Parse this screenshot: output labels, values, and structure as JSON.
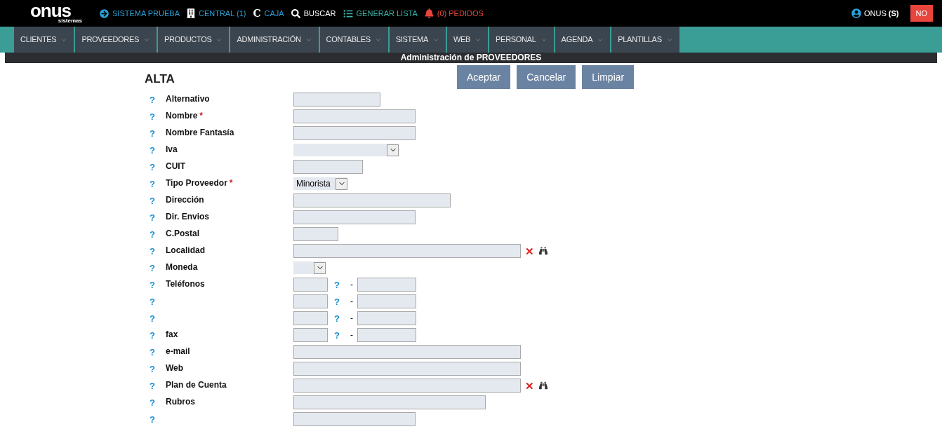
{
  "logo": {
    "word": "onus",
    "sub": "sistemas"
  },
  "topbar": [
    {
      "kind": "arrow",
      "label": "SISTEMA PRUEBA"
    },
    {
      "kind": "building",
      "label": "CENTRAL (1)"
    },
    {
      "kind": "letter",
      "glyph": "C",
      "label": "CAJA"
    },
    {
      "kind": "search",
      "label": "BUSCAR"
    },
    {
      "kind": "list",
      "label": "GENERAR LISTA"
    },
    {
      "kind": "bell",
      "label": "(0) PEDIDOS"
    }
  ],
  "user": {
    "name": "ONUS",
    "tag": "(S)"
  },
  "no_button": "NO",
  "menu": [
    "CLIENTES",
    "PROVEEDORES",
    "PRODUCTOS",
    "ADMINISTRACIÓN",
    "CONTABLES",
    "SISTEMA",
    "WEB",
    "PERSONAL",
    "AGENDA",
    "PLANTILLAS"
  ],
  "section_title": "Administración de PROVEEDORES",
  "form_title": "ALTA",
  "buttons": [
    "Aceptar",
    "Cancelar",
    "Limpiar"
  ],
  "fields": [
    {
      "help": "?",
      "label": "Alternativo",
      "kind": "text"
    },
    {
      "help": "?",
      "label": "Nombre",
      "required_mark": "*",
      "kind": "text"
    },
    {
      "help": "?",
      "label": "Nombre Fantasía",
      "kind": "text"
    },
    {
      "help": "?",
      "label": "Iva",
      "kind": "select"
    },
    {
      "help": "?",
      "label": "CUIT",
      "kind": "text"
    },
    {
      "help": "?",
      "label": "Tipo Proveedor",
      "required_mark": "*",
      "kind": "select",
      "value": "Minorista"
    },
    {
      "help": "?",
      "label": "Dirección",
      "kind": "text"
    },
    {
      "help": "?",
      "label": "Dir. Envios",
      "kind": "text"
    },
    {
      "help": "?",
      "label": "C.Postal",
      "kind": "text"
    },
    {
      "help": "?",
      "label": "Localidad",
      "kind": "lookup",
      "clear": "✕"
    },
    {
      "help": "?",
      "label": "Moneda",
      "kind": "select"
    },
    {
      "help": "?",
      "label": "Teléfonos",
      "kind": "phone",
      "inner_help": "?",
      "dash": "-"
    },
    {
      "help": "?",
      "kind": "phone",
      "inner_help": "?",
      "dash": "-"
    },
    {
      "help": "?",
      "kind": "phone",
      "inner_help": "?",
      "dash": "-"
    },
    {
      "help": "?",
      "label": "fax",
      "kind": "phone",
      "inner_help": "?",
      "dash": "-"
    },
    {
      "help": "?",
      "label": "e-mail",
      "kind": "text"
    },
    {
      "help": "?",
      "label": "Web",
      "kind": "text"
    },
    {
      "help": "?",
      "label": "Plan de Cuenta",
      "kind": "lookup",
      "clear": "✕"
    },
    {
      "help": "?",
      "label": "Rubros",
      "kind": "text"
    },
    {
      "help": "?",
      "kind": "text"
    }
  ]
}
